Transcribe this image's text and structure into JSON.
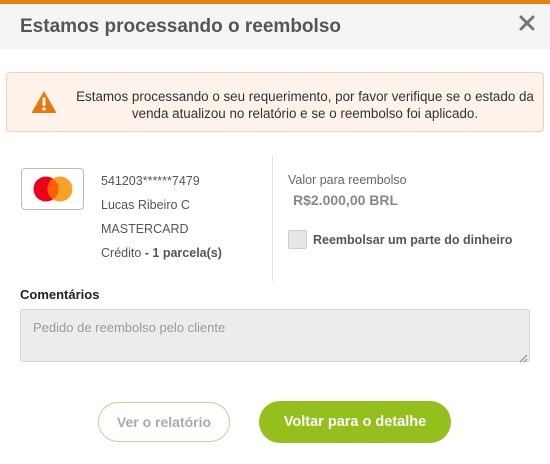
{
  "colors": {
    "accent_strip": "#e8820c",
    "alert_bg": "#fdf3ea",
    "warning_icon": "#e8790c",
    "primary_button": "#95bf1c",
    "mastercard_red": "#eb001b",
    "mastercard_orange": "#f79e1b"
  },
  "modal": {
    "title": "Estamos processando o reembolso",
    "close_icon": "close-icon"
  },
  "alert": {
    "icon": "warning-icon",
    "message": "Estamos processando o seu requerimento, por favor verifique se o estado da venda atualizou no relatório e se o reembolso foi aplicado."
  },
  "card": {
    "logo": "mastercard-logo",
    "number": "541203******7479",
    "holder": "Lucas Ribeiro C",
    "brand": "MASTERCARD",
    "type": "Crédito",
    "installments": "- 1 parcela(s)"
  },
  "refund": {
    "label": "Valor para reembolso",
    "value": "R$2.000,00 BRL",
    "partial_label": "Reembolsar um parte do dinheiro",
    "partial_checked": false
  },
  "comments": {
    "label": "Comentários",
    "placeholder": "Pedido de reembolso pelo cliente",
    "value": ""
  },
  "buttons": {
    "report_label": "Ver o relatório",
    "back_label": "Voltar para o detalhe"
  }
}
